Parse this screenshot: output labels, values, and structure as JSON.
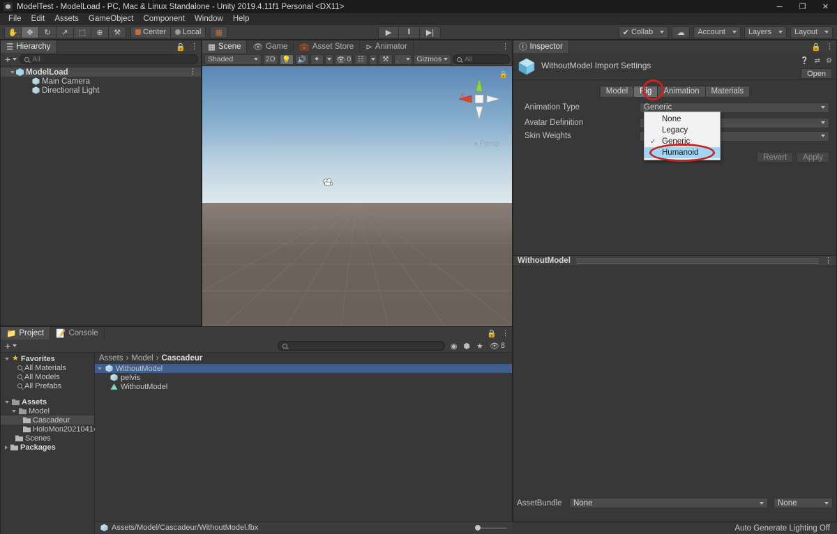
{
  "window": {
    "title": "ModelTest - ModelLoad - PC, Mac & Linux Standalone - Unity 2019.4.11f1 Personal <DX11>",
    "minimize": "─",
    "maximize": "❐",
    "close": "✕"
  },
  "menubar": {
    "items": [
      "File",
      "Edit",
      "Assets",
      "GameObject",
      "Component",
      "Window",
      "Help"
    ]
  },
  "toolbar": {
    "tools": [
      {
        "name": "hand-tool",
        "glyph": "✋",
        "active": false
      },
      {
        "name": "move-tool",
        "glyph": "✥",
        "active": true
      },
      {
        "name": "rotate-tool",
        "glyph": "↻",
        "active": false
      },
      {
        "name": "scale-tool",
        "glyph": "↗",
        "active": false
      },
      {
        "name": "rect-tool",
        "glyph": "⬚",
        "active": false
      },
      {
        "name": "transform-tool",
        "glyph": "⊕",
        "active": false
      },
      {
        "name": "custom-tool",
        "glyph": "⚒",
        "active": false
      }
    ],
    "pivot_mode": "Center",
    "pivot_rotation": "Local",
    "snap_icon": "grid-snap-icon",
    "play": "▶",
    "pause": "‖",
    "step": "▶|",
    "collab": "Collab",
    "cloud_icon": "cloud-icon",
    "account": "Account",
    "layers": "Layers",
    "layout": "Layout"
  },
  "hierarchy": {
    "tab": "Hierarchy",
    "add_label": "+",
    "search_placeholder": "All",
    "items": [
      {
        "label": "ModelLoad",
        "icon": "unity-scene-icon",
        "depth": 0,
        "expanded": true,
        "bold": true
      },
      {
        "label": "Main Camera",
        "icon": "gameobject-icon",
        "depth": 1
      },
      {
        "label": "Directional Light",
        "icon": "gameobject-icon",
        "depth": 1
      }
    ]
  },
  "scene": {
    "tabs": [
      {
        "label": "Scene",
        "icon": "scene-icon",
        "active": true
      },
      {
        "label": "Game",
        "icon": "game-icon",
        "active": false
      },
      {
        "label": "Asset Store",
        "icon": "store-icon",
        "active": false
      },
      {
        "label": "Animator",
        "icon": "animator-icon",
        "active": false
      }
    ],
    "draw_mode": "Shaded",
    "mode_2d": "2D",
    "lighting_icon": "light-bulb-icon",
    "audio_icon": "audio-icon",
    "fx_icon": "fx-icon",
    "visibility_count": "0",
    "scene_vis_icon": "scene-visibility-icon",
    "grid_icon": "grid-icon",
    "component_icon": "component-tools-icon",
    "camera_icon": "scene-camera-icon",
    "gizmos": "Gizmos",
    "search_placeholder": "All",
    "persp_label": "◂ Persp",
    "axis_x": "x",
    "axis_y": "y"
  },
  "inspector": {
    "tab": "Inspector",
    "asset_title": "WithoutModel Import Settings",
    "open_button": "Open",
    "header_icons": [
      "help-icon",
      "preset-icon",
      "settings-gear-icon"
    ],
    "tabs": [
      {
        "label": "Model",
        "active": false
      },
      {
        "label": "Rig",
        "active": true
      },
      {
        "label": "Animation",
        "active": false
      },
      {
        "label": "Materials",
        "active": false
      }
    ],
    "properties": [
      {
        "label": "Animation Type",
        "value": "Generic"
      },
      {
        "label": "Avatar Definition",
        "value": ""
      },
      {
        "label": "Skin Weights",
        "value": ""
      }
    ],
    "revert": "Revert",
    "apply": "Apply",
    "preview_title": "WithoutModel",
    "assetbundle_label": "AssetBundle",
    "assetbundle_value": "None",
    "assetbundle_variant": "None",
    "status_text": "Auto Generate Lighting Off"
  },
  "animation_type_dropdown": {
    "open": true,
    "options": [
      {
        "label": "None",
        "checked": false,
        "highlighted": false
      },
      {
        "label": "Legacy",
        "checked": false,
        "highlighted": false
      },
      {
        "label": "Generic",
        "checked": true,
        "highlighted": false
      },
      {
        "label": "Humanoid",
        "checked": false,
        "highlighted": true
      }
    ],
    "check_glyph": "✓"
  },
  "project": {
    "tabs": [
      {
        "label": "Project",
        "icon": "project-icon",
        "active": true
      },
      {
        "label": "Console",
        "icon": "console-icon",
        "active": false
      }
    ],
    "add_label": "+",
    "search_placeholder": "",
    "toolbar_icons": [
      "new-asset-icon",
      "label-icon",
      "favorite-star-icon",
      "hidden-packages-icon"
    ],
    "hidden_count": "8",
    "tree": [
      {
        "label": "Favorites",
        "icon": "star-icon",
        "depth": 0,
        "expanded": true,
        "bold": true
      },
      {
        "label": "All Materials",
        "icon": "search-icon",
        "depth": 1
      },
      {
        "label": "All Models",
        "icon": "search-icon",
        "depth": 1
      },
      {
        "label": "All Prefabs",
        "icon": "search-icon",
        "depth": 1
      },
      {
        "label": "Assets",
        "icon": "folder-icon",
        "depth": 0,
        "expanded": true,
        "bold": true
      },
      {
        "label": "Model",
        "icon": "folder-icon",
        "depth": 1,
        "expanded": true,
        "bold": false
      },
      {
        "label": "Cascadeur",
        "icon": "folder-icon",
        "depth": 2,
        "selected": true
      },
      {
        "label": "HoloMon2021041‹",
        "icon": "folder-icon",
        "depth": 2
      },
      {
        "label": "Scenes",
        "icon": "folder-icon",
        "depth": 1
      },
      {
        "label": "Packages",
        "icon": "folder-icon",
        "depth": 0,
        "expanded": false,
        "bold": true
      }
    ],
    "breadcrumb": [
      "Assets",
      "Model",
      "Cascadeur"
    ],
    "assets": [
      {
        "label": "WithoutModel",
        "icon": "fbx-model-icon",
        "depth": 0,
        "expanded": true,
        "selected": true
      },
      {
        "label": "pelvis",
        "icon": "fbx-model-icon",
        "depth": 1,
        "selected": false
      },
      {
        "label": "WithoutModel",
        "icon": "mesh-icon",
        "depth": 1,
        "selected": false
      }
    ],
    "status_path": "Assets/Model/Cascadeur/WithoutModel.fbx",
    "status_icon": "fbx-model-icon"
  },
  "colors": {
    "annotation_red": "#c8241f",
    "selection_blue": "#3f5e8e",
    "dropdown_highlight": "#9fd5f5"
  }
}
